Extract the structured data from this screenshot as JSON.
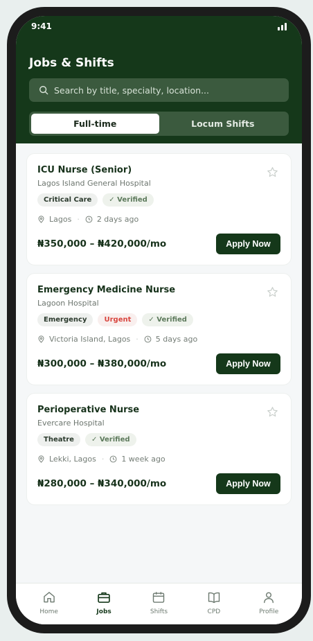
{
  "status_bar": {
    "time": "9:41"
  },
  "header": {
    "title": "Jobs & Shifts",
    "search_placeholder": "Search by title, specialty, location..."
  },
  "segmented": {
    "tabs": [
      {
        "label": "Full-time",
        "active": true
      },
      {
        "label": "Locum Shifts",
        "active": false
      }
    ]
  },
  "jobs": [
    {
      "title": "ICU Nurse (Senior)",
      "company": "Lagos Island General Hospital",
      "tags": [
        "Critical Care",
        "✓ Verified"
      ],
      "location": "Lagos",
      "posted": "2 days ago",
      "salary": "₦350,000 – ₦420,000/mo",
      "apply_label": "Apply Now"
    },
    {
      "title": "Emergency Medicine Nurse",
      "company": "Lagoon Hospital",
      "tags": [
        "Emergency",
        "Urgent",
        "✓ Verified"
      ],
      "location": "Victoria Island, Lagos",
      "posted": "5 days ago",
      "salary": "₦300,000 – ₦380,000/mo",
      "apply_label": "Apply Now"
    },
    {
      "title": "Perioperative Nurse",
      "company": "Evercare Hospital",
      "tags": [
        "Theatre",
        "✓ Verified"
      ],
      "location": "Lekki, Lagos",
      "posted": "1 week ago",
      "salary": "₦280,000 – ₦340,000/mo",
      "apply_label": "Apply Now"
    }
  ],
  "tabbar": {
    "items": [
      {
        "label": "Home",
        "icon": "home-icon"
      },
      {
        "label": "Jobs",
        "icon": "briefcase-icon",
        "active": true
      },
      {
        "label": "Shifts",
        "icon": "calendar-icon"
      },
      {
        "label": "CPD",
        "icon": "book-icon"
      },
      {
        "label": "Profile",
        "icon": "person-icon"
      }
    ]
  },
  "colors": {
    "primary": "#15381a",
    "urgent": "#d8453e",
    "verified": "#5d7a5c"
  }
}
